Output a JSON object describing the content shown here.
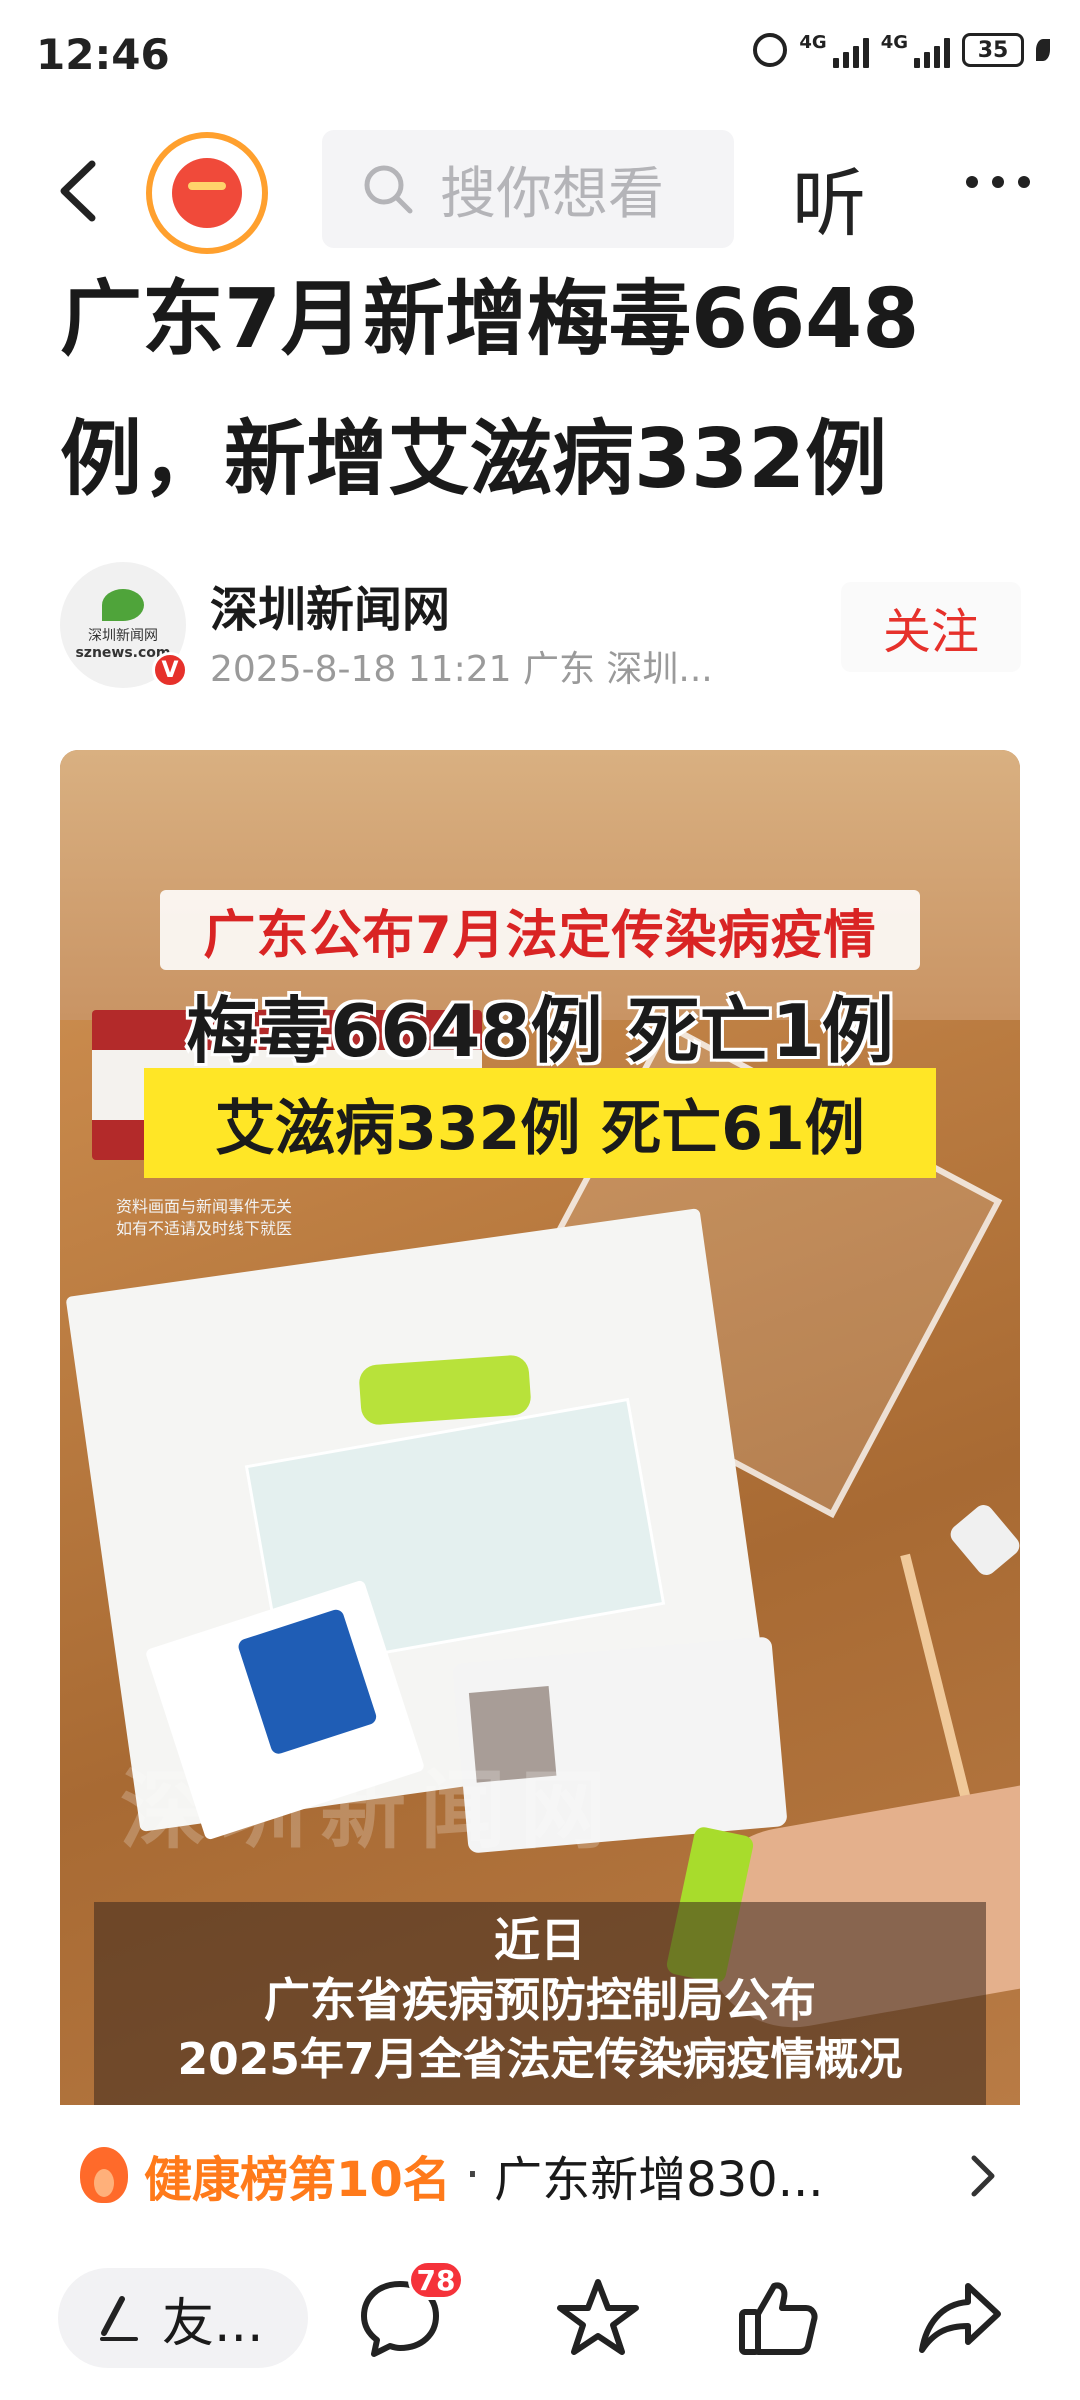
{
  "status_bar": {
    "time": "12:46",
    "sim1": "4G",
    "sim2": "4G",
    "battery": "35"
  },
  "nav": {
    "search_placeholder": "搜你想看",
    "listen_label": "听",
    "back_icon": "back-arrow-icon",
    "more_icon": "more-dots-icon",
    "redpacket_icon": "red-packet-icon"
  },
  "article": {
    "title": "广东7月新增梅毒6648例，新增艾滋病332例"
  },
  "author": {
    "name": "深圳新闻网",
    "avatar_text_1": "深圳新闻网",
    "avatar_text_2": "sznews.com",
    "verified": "V",
    "meta": "2025-8-18  11:21  广东  深圳...",
    "follow_label": "关注"
  },
  "media": {
    "headline_red": "广东公布7月法定传染病疫情",
    "headline_big": "梅毒6648例 死亡1例",
    "headline_yellow": "艾滋病332例 死亡61例",
    "disclaimer_1": "资料画面与新闻事件无关",
    "disclaimer_2": "如有不适请及时线下就医",
    "watermark": "深圳新闻网",
    "subtitle_1": "近日",
    "subtitle_2": "广东省疾病预防控制局公布",
    "subtitle_3": "2025年7月全省法定传染病疫情概况"
  },
  "hot_rank": {
    "label": "健康榜第10名",
    "separator": "·",
    "text": "广东新增830..."
  },
  "bottom_bar": {
    "comment_placeholder": "友...",
    "comment_count": "78"
  },
  "colors": {
    "accent_red": "#e6312b",
    "rank_orange": "#ff7a1a",
    "highlight_yellow": "#ffe626"
  }
}
